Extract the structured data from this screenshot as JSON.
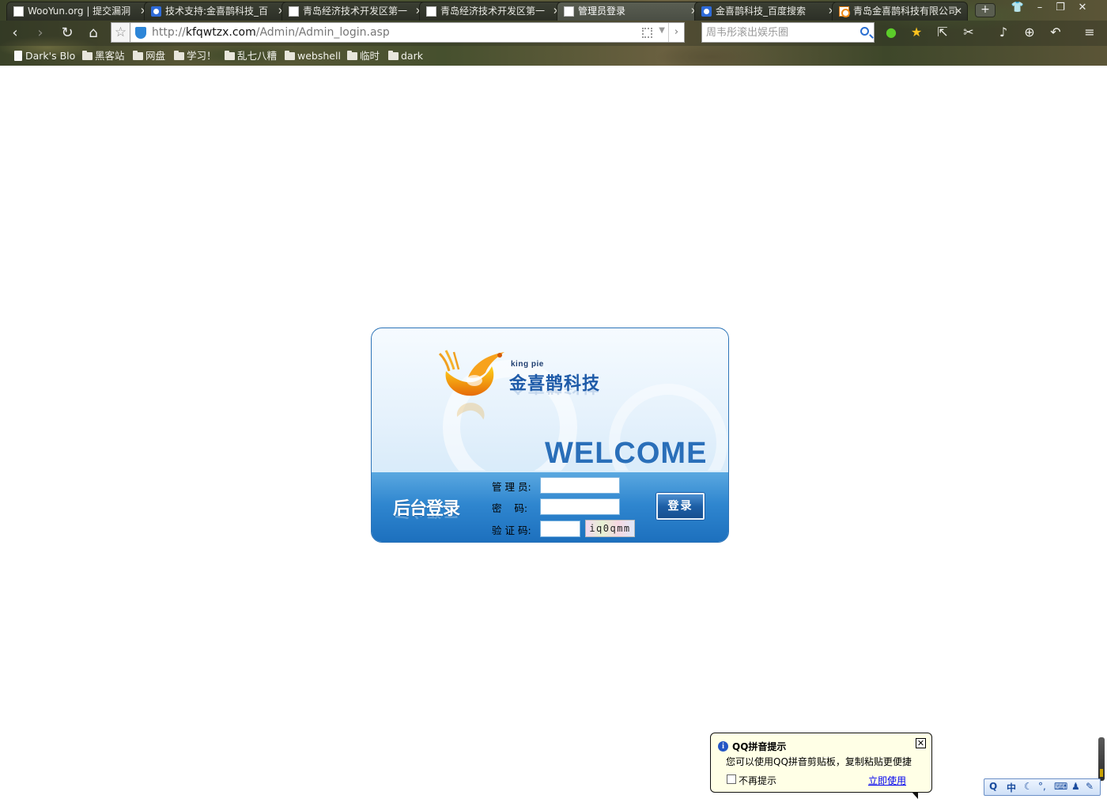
{
  "browser": {
    "tabs": [
      {
        "title": "WooYun.org | 提交漏洞",
        "favicon": "page-icon"
      },
      {
        "title": "技术支持:金喜鹊科技_百",
        "favicon": "baidu-icon"
      },
      {
        "title": "青岛经济技术开发区第一",
        "favicon": "page-icon"
      },
      {
        "title": "青岛经济技术开发区第一",
        "favicon": "page-icon"
      },
      {
        "title": "管理员登录",
        "favicon": "page-icon",
        "active": true
      },
      {
        "title": "金喜鹊科技_百度搜索",
        "favicon": "baidu-icon"
      },
      {
        "title": "青岛金喜鹊科技有限公司",
        "favicon": "site-icon"
      }
    ],
    "new_tab_label": "+",
    "url": {
      "scheme": "http://",
      "host": "kfqwtzx.com",
      "path": "/Admin/Admin_login.asp"
    },
    "search_placeholder": "周韦彤滚出娱乐圈",
    "bookmarks": [
      {
        "label": "Dark's Blo",
        "type": "page"
      },
      {
        "label": "黑客站",
        "type": "folder"
      },
      {
        "label": "网盘",
        "type": "folder"
      },
      {
        "label": "学习！",
        "type": "folder"
      },
      {
        "label": "乱七八糟",
        "type": "folder"
      },
      {
        "label": "webshell",
        "type": "folder"
      },
      {
        "label": "临时",
        "type": "folder"
      },
      {
        "label": "dark",
        "type": "folder"
      }
    ]
  },
  "login": {
    "logo_en": "king pie",
    "logo_cn": "金喜鹊科技",
    "welcome": "WELCOME",
    "heading": "后台登录",
    "username_label": "管 理 员:",
    "password_label": "密    码:",
    "captcha_label": "验 证 码:",
    "captcha_text": "iq0qmm",
    "submit_label": "登录",
    "colors": {
      "panel_blue": "#2f86cf",
      "welcome_blue": "#2a6fb9",
      "logo_orange": "#f08c1c"
    }
  },
  "qq_popup": {
    "title": "QQ拼音提示",
    "message": "您可以使用QQ拼音剪贴板，复制粘贴更便捷",
    "checkbox_label": "不再提示",
    "link_label": "立即使用"
  },
  "ime_bar": {
    "mode_label": "中"
  }
}
